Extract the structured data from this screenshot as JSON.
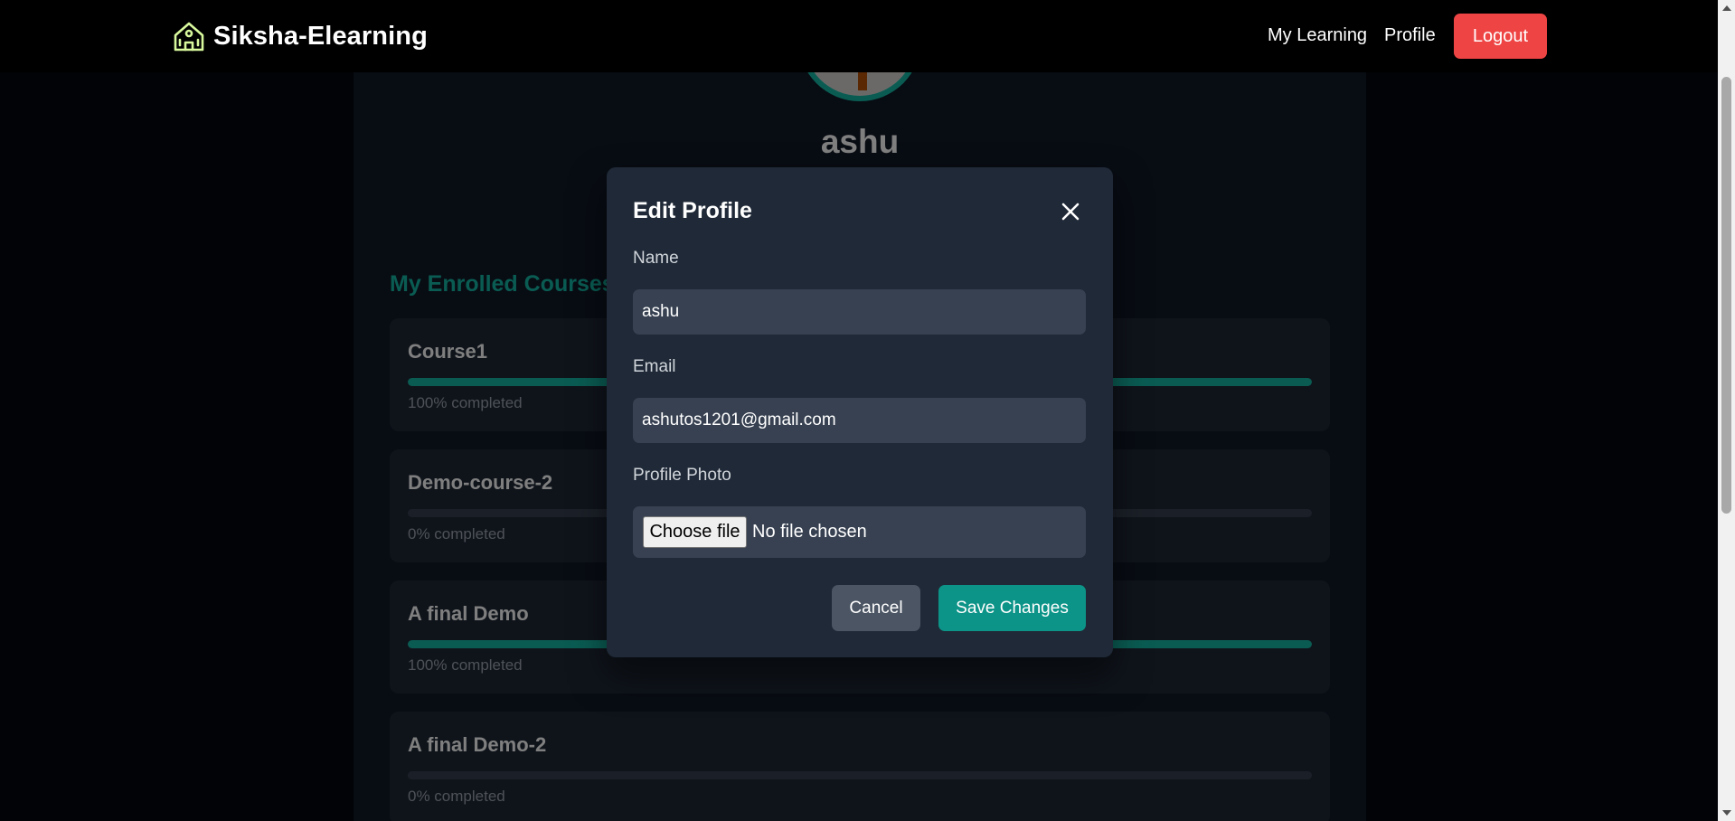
{
  "navbar": {
    "brand_name": "Siksha-Elearning",
    "brand_icon": "school-icon",
    "links": [
      "My Learning",
      "Profile"
    ],
    "logout_label": "Logout"
  },
  "profile": {
    "user_name": "ashu",
    "section_title": "My Enrolled Courses",
    "courses": [
      {
        "title": "Course1",
        "progress_pct": 100,
        "progress_text": "100% completed"
      },
      {
        "title": "Demo-course-2",
        "progress_pct": 0,
        "progress_text": "0% completed"
      },
      {
        "title": "A final Demo",
        "progress_pct": 100,
        "progress_text": "100% completed"
      },
      {
        "title": "A final Demo-2",
        "progress_pct": 0,
        "progress_text": "0% completed"
      }
    ]
  },
  "modal": {
    "title": "Edit Profile",
    "close_icon": "close-icon",
    "name_label": "Name",
    "name_value": "ashu",
    "email_label": "Email",
    "email_value": "ashutos1201@gmail.com",
    "photo_label": "Profile Photo",
    "choose_file_label": "Choose file",
    "file_status": "No file chosen",
    "cancel_label": "Cancel",
    "save_label": "Save Changes"
  },
  "colors": {
    "accent": "#14b8a6",
    "save_button": "#0d9488",
    "logout_button": "#ef4444",
    "modal_bg": "#1f2937",
    "input_bg": "#374151"
  }
}
